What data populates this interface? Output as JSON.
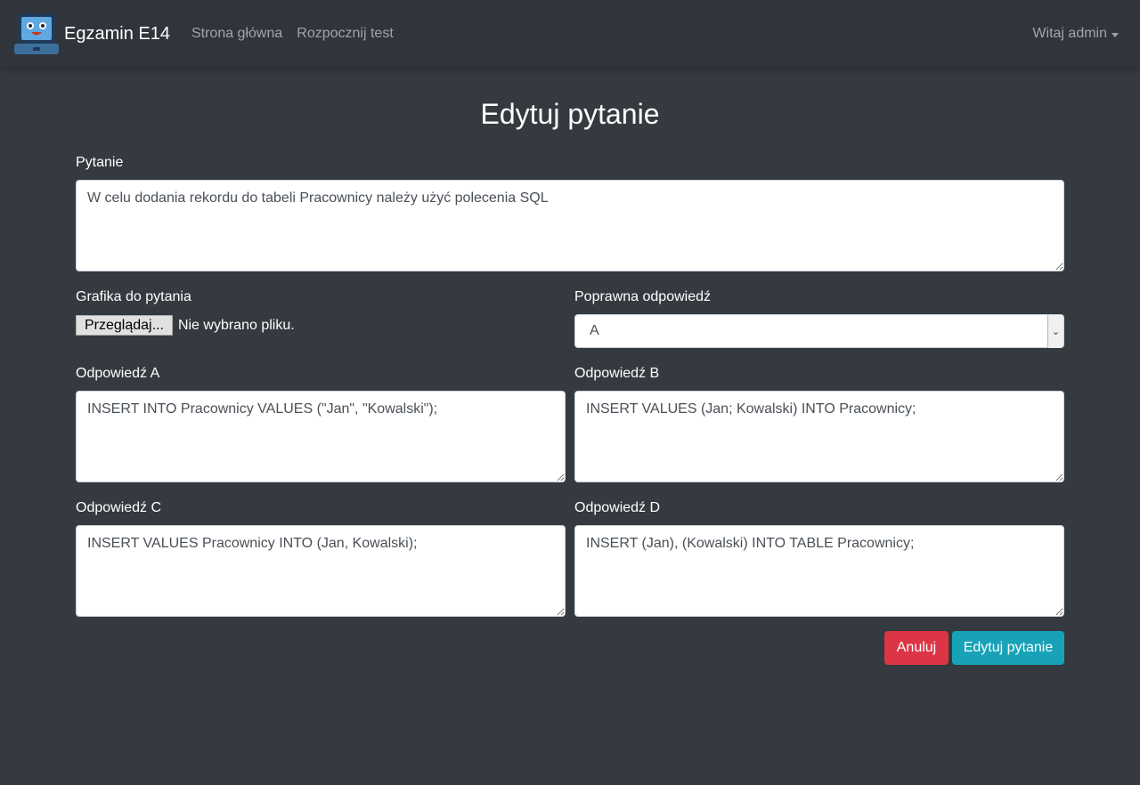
{
  "navbar": {
    "brand": "Egzamin E14",
    "links": [
      "Strona główna",
      "Rozpocznij test"
    ],
    "user": "Witaj admin"
  },
  "page": {
    "title": "Edytuj pytanie"
  },
  "form": {
    "question": {
      "label": "Pytanie",
      "value": "W celu dodania rekordu do tabeli Pracownicy należy użyć polecenia SQL"
    },
    "image": {
      "label": "Grafika do pytania",
      "button": "Przeglądaj...",
      "status": "Nie wybrano pliku."
    },
    "correct": {
      "label": "Poprawna odpowiedź",
      "value": "A"
    },
    "answers": [
      {
        "label": "Odpowiedź A",
        "value": "INSERT INTO Pracownicy VALUES (\"Jan\", \"Kowalski\");"
      },
      {
        "label": "Odpowiedź B",
        "value": "INSERT VALUES (Jan; Kowalski) INTO Pracownicy;"
      },
      {
        "label": "Odpowiedź C",
        "value": "INSERT VALUES Pracownicy INTO (Jan, Kowalski);"
      },
      {
        "label": "Odpowiedź D",
        "value": "INSERT (Jan), (Kowalski) INTO TABLE Pracownicy;"
      }
    ],
    "cancel": "Anuluj",
    "submit": "Edytuj pytanie"
  },
  "colors": {
    "background": "#343a40",
    "navbar": "#2f353b",
    "danger": "#dc3545",
    "info": "#17a2b8"
  },
  "icons": {
    "logo": "laptop-mascot-icon",
    "dropdown": "caret-down-icon"
  }
}
